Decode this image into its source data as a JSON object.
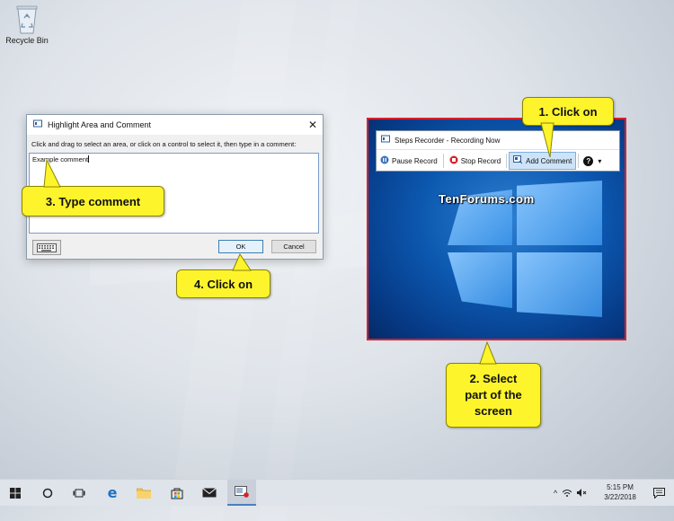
{
  "desktop": {
    "recycle_bin_label": "Recycle Bin"
  },
  "dialog": {
    "title": "Highlight Area and Comment",
    "instruction": "Click and drag to select an area, or click on a control to select it, then type in a comment:",
    "comment_value": "Example comment",
    "ok_label": "OK",
    "cancel_label": "Cancel",
    "close_glyph": "✕"
  },
  "recorder": {
    "title": "Steps Recorder - Recording Now",
    "pause_label": "Pause Record",
    "stop_label": "Stop Record",
    "add_comment_label": "Add Comment",
    "help_glyph": "?",
    "dropdown_glyph": "▾"
  },
  "watermark": "TenForums.com",
  "callouts": {
    "step1": "1. Click on",
    "step2_line1": "2. Select",
    "step2_line2": "part of the",
    "step2_line3": "screen",
    "step3": "3. Type comment",
    "step4": "4. Click on"
  },
  "taskbar": {
    "time": "5:15 PM",
    "date": "3/22/2018",
    "caret_glyph": "^"
  },
  "colors": {
    "callout": "#fdf42c",
    "selection_border": "#d9212c",
    "desktop_blue": "#0c58b0"
  }
}
